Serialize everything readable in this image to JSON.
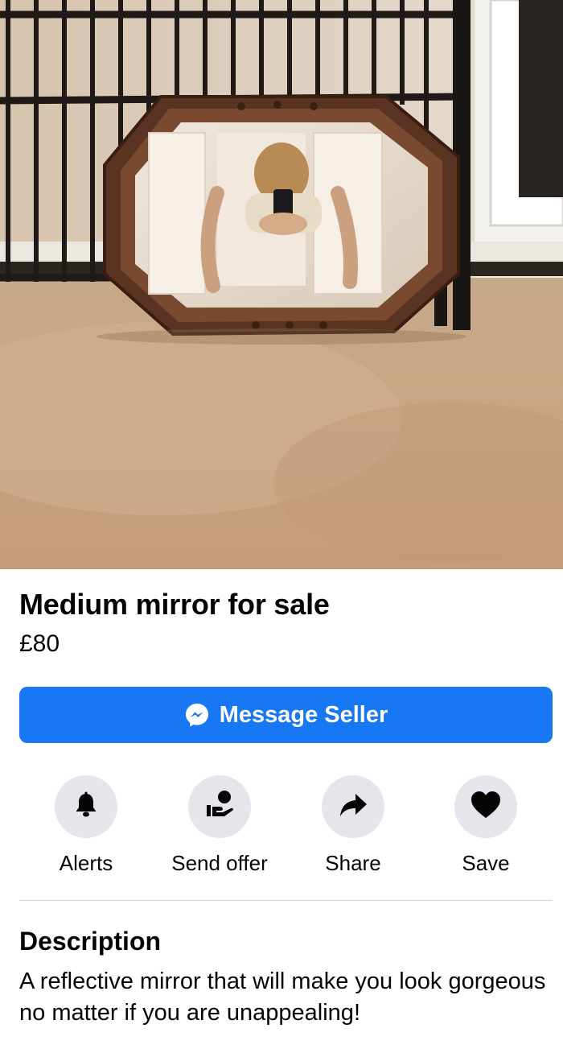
{
  "listing": {
    "title": "Medium mirror for sale",
    "price": "£80"
  },
  "message_button": {
    "label": "Message Seller",
    "icon": "messenger-icon",
    "color": "#1877f2"
  },
  "actions": [
    {
      "label": "Alerts",
      "icon": "bell-icon"
    },
    {
      "label": "Send offer",
      "icon": "send-offer-icon"
    },
    {
      "label": "Share",
      "icon": "share-arrow-icon"
    },
    {
      "label": "Save",
      "icon": "heart-icon"
    }
  ],
  "description": {
    "heading": "Description",
    "text": "A reflective mirror that will make you look gorgeous no matter if you are unappealing!"
  }
}
